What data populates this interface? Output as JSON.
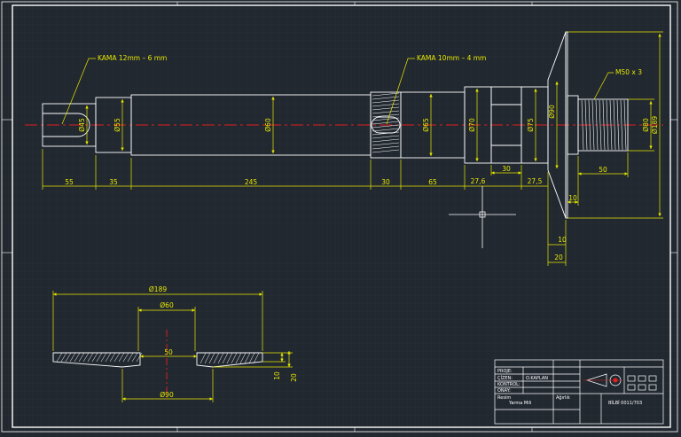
{
  "drawing": {
    "colors": {
      "background": "#212830",
      "frame": "#ffffff",
      "part": "#ffffff",
      "dimension": "#e8e800",
      "centerline": "#e02020",
      "grid": "#2c343d"
    },
    "annotations": {
      "kama1": "KAMA 12mm – 6 mm",
      "kama2": "KAMA 10mm – 4 mm",
      "thread": "M50 x 3"
    },
    "shaft_dims": {
      "d45": "Ø45",
      "d55": "Ø55",
      "d60": "Ø60",
      "d65": "Ø65",
      "d70": "Ø70",
      "d75": "Ø75",
      "d90": "Ø90",
      "d80": "Ø80",
      "d189": "Ø189",
      "l55": "55",
      "l35": "35",
      "l245": "245",
      "l30a": "30",
      "l65": "65",
      "l276a": "27,6",
      "l30b": "30",
      "l275": "27,5",
      "l50": "50",
      "l10a": "10",
      "l10b": "10",
      "l20": "20"
    },
    "section_dims": {
      "d189": "Ø189",
      "d60": "Ø60",
      "w50": "50",
      "d90": "Ø90",
      "h10": "10",
      "h20": "20"
    },
    "title_block": {
      "proje": "PROJE:",
      "cizen": "ÇİZEN:",
      "cizen_name": "O.KAPLAN",
      "kontrol": "KONTROL:",
      "onay": "ONAY:",
      "resim": "Resim",
      "resim_name": "Yarma Mili",
      "agirlik": "Ağırlık",
      "drawing_no": "BİLBİ 0011/703"
    }
  }
}
